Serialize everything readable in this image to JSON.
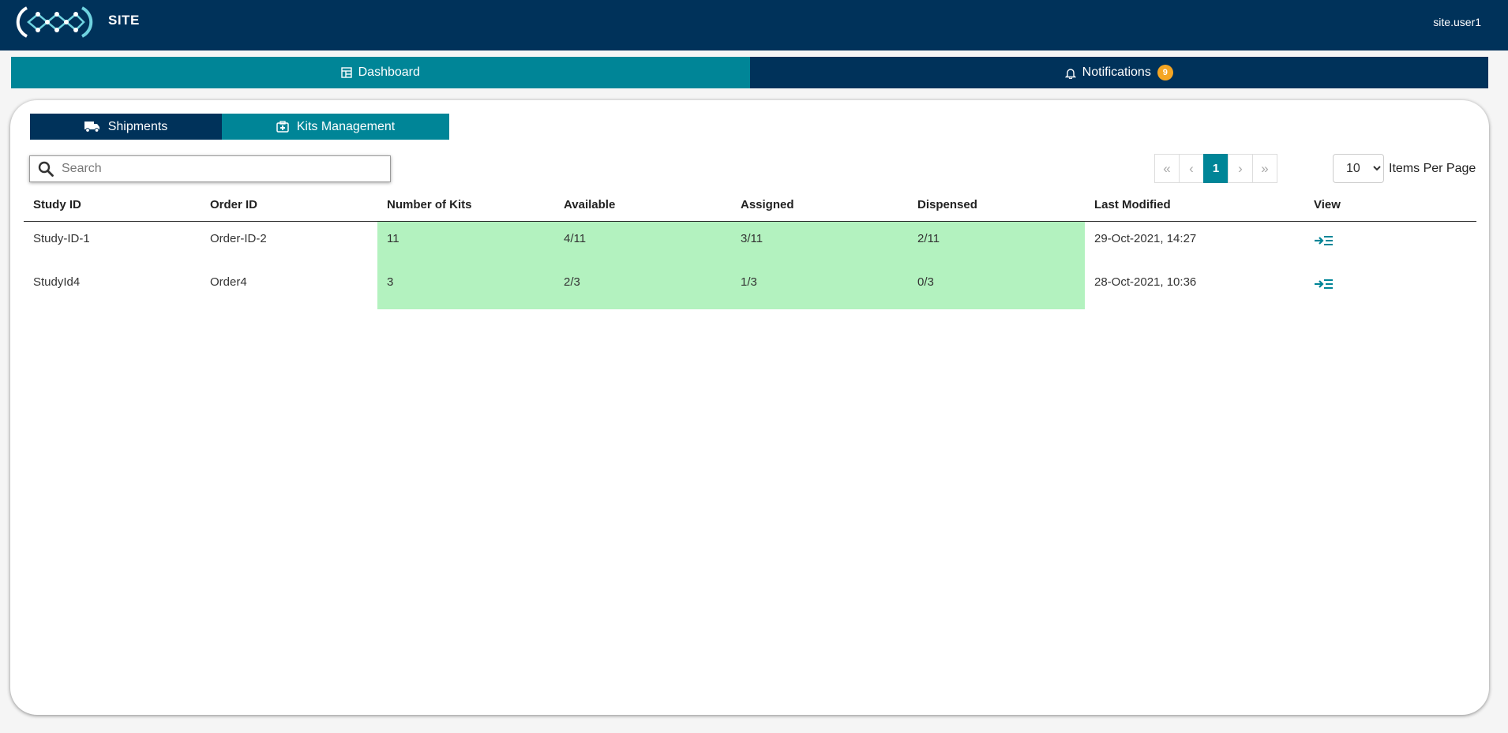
{
  "header": {
    "app_title": "SITE",
    "user": "site.user1"
  },
  "nav": {
    "dashboard_label": "Dashboard",
    "notifications_label": "Notifications",
    "notifications_count": "9"
  },
  "subtabs": {
    "shipments_label": "Shipments",
    "kits_label": "Kits Management"
  },
  "search": {
    "placeholder": "Search",
    "value": ""
  },
  "pagination": {
    "first": "«",
    "prev": "‹",
    "current": "1",
    "next": "›",
    "last": "»",
    "items_per_page_value": "10",
    "items_per_page_label": "Items Per Page"
  },
  "table": {
    "columns": [
      "Study ID",
      "Order ID",
      "Number of Kits",
      "Available",
      "Assigned",
      "Dispensed",
      "Last Modified",
      "View"
    ],
    "rows": [
      {
        "study_id": "Study-ID-1",
        "order_id": "Order-ID-2",
        "kits": "11",
        "available": "4/11",
        "assigned": "3/11",
        "dispensed": "2/11",
        "modified": "29-Oct-2021, 14:27"
      },
      {
        "study_id": "StudyId4",
        "order_id": "Order4",
        "kits": "3",
        "available": "2/3",
        "assigned": "1/3",
        "dispensed": "0/3",
        "modified": "28-Oct-2021, 10:36"
      }
    ]
  },
  "colors": {
    "primary_dark": "#00325a",
    "teal": "#008597",
    "highlight_green": "#b3f2bf",
    "badge_orange": "#f5a623"
  },
  "icons": [
    "logo-icon",
    "dashboard-icon",
    "bell-icon",
    "truck-icon",
    "kit-icon",
    "search-icon",
    "view-details-icon"
  ]
}
